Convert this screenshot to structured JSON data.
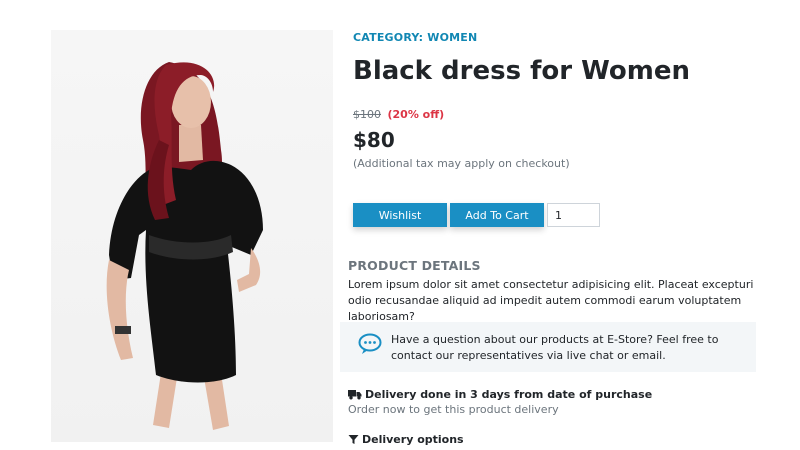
{
  "product": {
    "category": "CATEGORY: WOMEN",
    "title": "Black dress for Women",
    "old_price": "$100",
    "discount": "(20% off)",
    "price": "$80",
    "tax_note": "(Additional tax may apply on checkout)",
    "image_alt": "Woman in black dress"
  },
  "actions": {
    "wishlist_label": "Wishlist",
    "add_to_cart_label": "Add To Cart",
    "quantity_value": "1"
  },
  "details": {
    "heading": "PRODUCT DETAILS",
    "text": "Lorem ipsum dolor sit amet consectetur adipisicing elit. Placeat excepturi odio recusandae aliquid ad impedit autem commodi earum voluptatem laboriosam?"
  },
  "support": {
    "icon": "chat-bubble-icon",
    "text": "Have a question about our products at E-Store? Feel free to contact our representatives via live chat or email."
  },
  "delivery": {
    "icon": "truck-icon",
    "title": "Delivery done in 3 days from date of purchase",
    "subtitle": "Order now to get this product delivery",
    "options_icon": "filter-icon",
    "options_label": "Delivery options"
  },
  "colors": {
    "accent": "#1a8fc4",
    "category": "#1187b3",
    "discount": "#dc3545",
    "muted": "#6c757d",
    "info_box": "#f3f6f8"
  }
}
